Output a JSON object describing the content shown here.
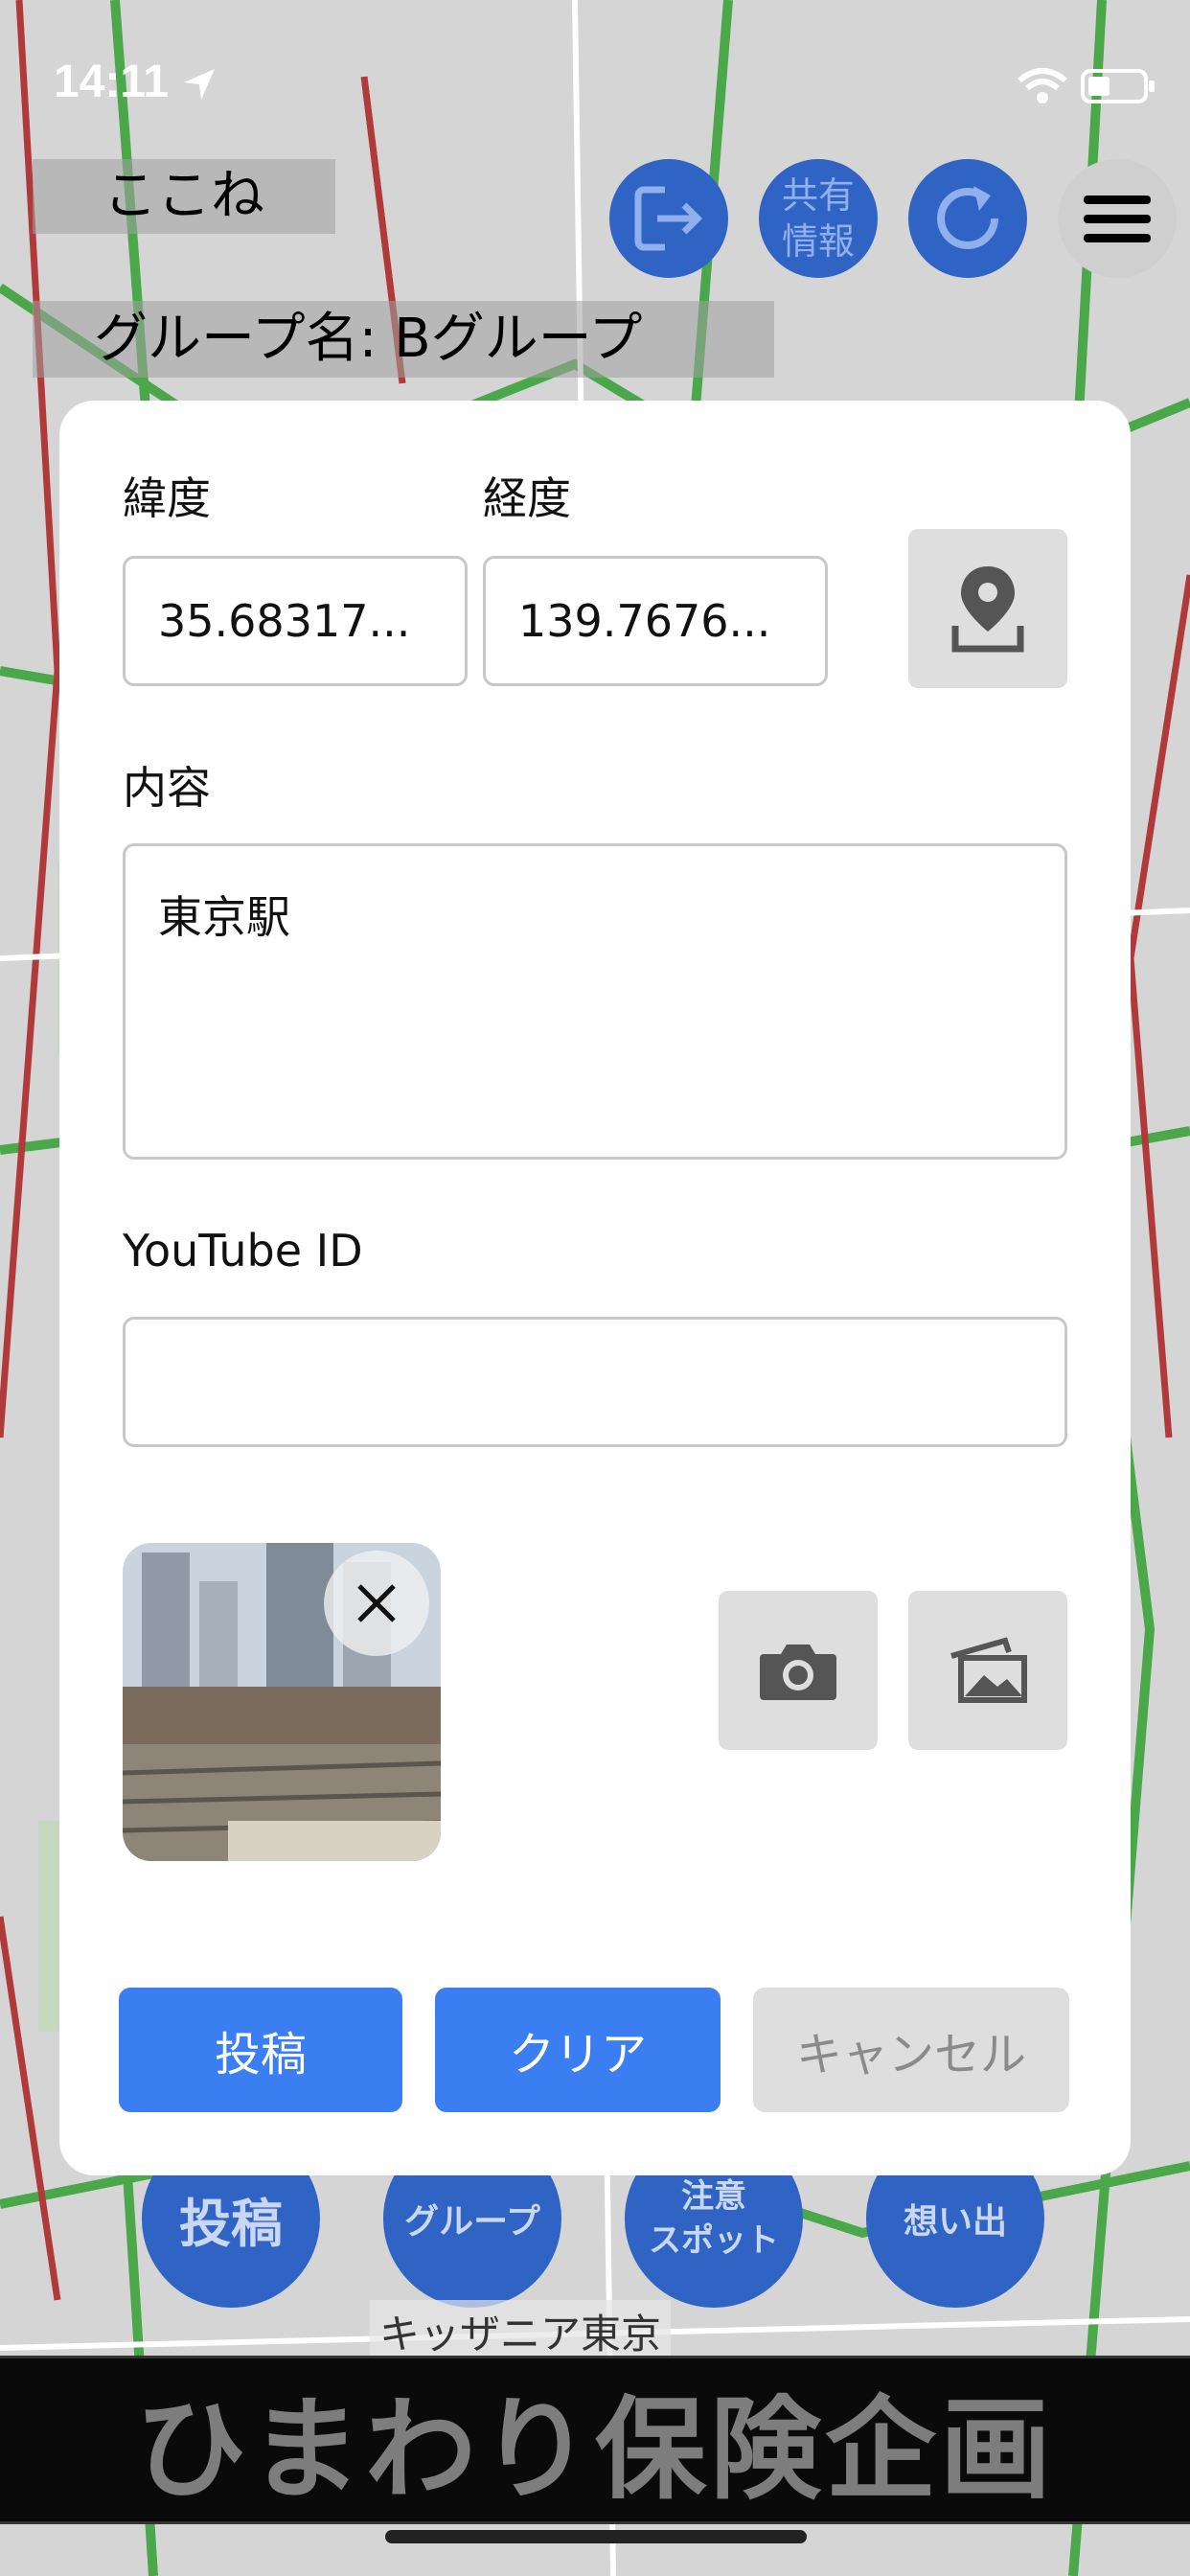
{
  "status_bar": {
    "time": "14:11"
  },
  "app": {
    "title": "ここね",
    "group_label": "グループ名: Bグループ"
  },
  "header_buttons": {
    "share_line1": "共有",
    "share_line2": "情報"
  },
  "form": {
    "latitude_label": "緯度",
    "latitude_value": "35.68317...",
    "longitude_label": "経度",
    "longitude_value": "139.7676...",
    "content_label": "内容",
    "content_value": "東京駅",
    "youtube_label": "YouTube ID",
    "youtube_value": "",
    "submit_label": "投稿",
    "clear_label": "クリア",
    "cancel_label": "キャンセル"
  },
  "map_buttons": {
    "post": "投稿",
    "group": "グループ",
    "caution_line1": "注意",
    "caution_line2": "スポット",
    "memories": "想い出",
    "place_label": "キッザニア東京"
  },
  "ad": {
    "text": "ひまわり保険企画"
  },
  "colors": {
    "primary_blue": "#3b7ef2",
    "map_button_blue": "#2f63c4",
    "disabled_gray": "#dedede"
  }
}
